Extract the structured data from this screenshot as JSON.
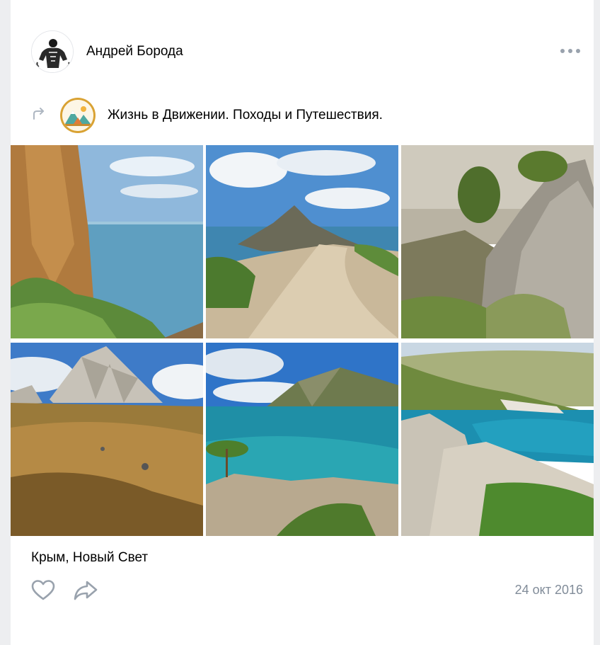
{
  "post": {
    "author_name": "Андрей Борода",
    "author_avatar_icon": "bodybuilder-avatar",
    "more_icon": "more-horizontal-icon",
    "repost_icon": "repost-arrow-icon",
    "source_group": {
      "name": "Жизнь в Движении. Походы и Путешествия.",
      "avatar_icon": "mountains-tent-logo",
      "accent_color": "#d9a233"
    },
    "photos": [
      {
        "subject": "coastal cliff over sea"
      },
      {
        "subject": "trail to rocky cape"
      },
      {
        "subject": "rocky mountain slope"
      },
      {
        "subject": "rock peak above autumn field"
      },
      {
        "subject": "turquoise bay with cliffs"
      },
      {
        "subject": "harbor bay among hills"
      }
    ],
    "caption": "Крым, Новый Свет",
    "like_icon": "heart-icon",
    "share_icon": "share-arrow-icon",
    "date": "24 окт 2016"
  }
}
